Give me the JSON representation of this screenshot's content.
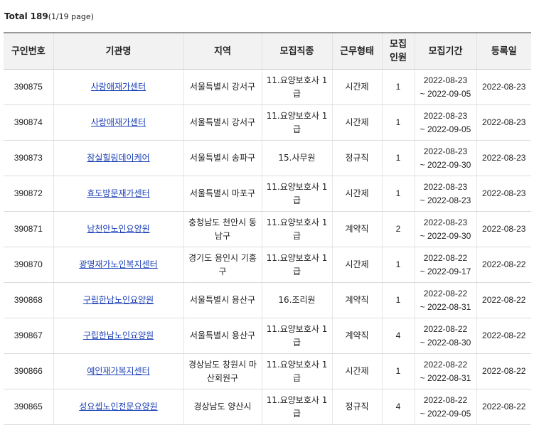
{
  "summary": {
    "total_label": "Total",
    "total_count": "189",
    "page_info": "(1/19 page)"
  },
  "table": {
    "headers": {
      "id": "구인번호",
      "org": "기관명",
      "region": "지역",
      "job": "모집직종",
      "type": "근무형태",
      "headcount": "모집\n인원",
      "period": "모집기간",
      "regdate": "등록일"
    },
    "rows": [
      {
        "id": "390875",
        "org": "사랑애재가센터",
        "region": "서울특별시 강서구",
        "job": "11.요양보호사 1급",
        "type": "시간제",
        "headcount": "1",
        "period_start": "2022-08-23",
        "period_end": "~ 2022-09-05",
        "regdate": "2022-08-23"
      },
      {
        "id": "390874",
        "org": "사랑애재가센터",
        "region": "서울특별시 강서구",
        "job": "11.요양보호사 1급",
        "type": "시간제",
        "headcount": "1",
        "period_start": "2022-08-23",
        "period_end": "~ 2022-09-05",
        "regdate": "2022-08-23"
      },
      {
        "id": "390873",
        "org": "잠실힐링데이케어",
        "region": "서울특별시 송파구",
        "job": "15.사무원",
        "type": "정규직",
        "headcount": "1",
        "period_start": "2022-08-23",
        "period_end": "~ 2022-09-30",
        "regdate": "2022-08-23"
      },
      {
        "id": "390872",
        "org": "효도방문재가센터",
        "region": "서울특별시 마포구",
        "job": "11.요양보호사 1급",
        "type": "시간제",
        "headcount": "1",
        "period_start": "2022-08-23",
        "period_end": "~ 2022-08-23",
        "regdate": "2022-08-23"
      },
      {
        "id": "390871",
        "org": "남천안노인요양원",
        "region": "충청남도 천안시 동남구",
        "job": "11.요양보호사 1급",
        "type": "계약직",
        "headcount": "2",
        "period_start": "2022-08-23",
        "period_end": "~ 2022-09-30",
        "regdate": "2022-08-23"
      },
      {
        "id": "390870",
        "org": "광명재가노인복지센터",
        "region": "경기도 용인시 기흥구",
        "job": "11.요양보호사 1급",
        "type": "시간제",
        "headcount": "1",
        "period_start": "2022-08-22",
        "period_end": "~ 2022-09-17",
        "regdate": "2022-08-22"
      },
      {
        "id": "390868",
        "org": "구립한남노인요양원",
        "region": "서울특별시 용산구",
        "job": "16.조리원",
        "type": "계약직",
        "headcount": "1",
        "period_start": "2022-08-22",
        "period_end": "~ 2022-08-31",
        "regdate": "2022-08-22"
      },
      {
        "id": "390867",
        "org": "구립한남노인요양원",
        "region": "서울특별시 용산구",
        "job": "11.요양보호사 1급",
        "type": "계약직",
        "headcount": "4",
        "period_start": "2022-08-22",
        "period_end": "~ 2022-08-30",
        "regdate": "2022-08-22"
      },
      {
        "id": "390866",
        "org": "예인재가복지센터",
        "region": "경상남도 창원시 마산회원구",
        "job": "11.요양보호사 1급",
        "type": "시간제",
        "headcount": "1",
        "period_start": "2022-08-22",
        "period_end": "~ 2022-08-31",
        "regdate": "2022-08-22"
      },
      {
        "id": "390865",
        "org": "성요셉노인전문요양원",
        "region": "경상남도 양산시",
        "job": "11.요양보호사 1급",
        "type": "정규직",
        "headcount": "4",
        "period_start": "2022-08-22",
        "period_end": "~ 2022-09-05",
        "regdate": "2022-08-22"
      }
    ]
  },
  "colors": {
    "link": "#1a3fb5",
    "header_bg": "#f2f2f2",
    "text": "#222222"
  }
}
